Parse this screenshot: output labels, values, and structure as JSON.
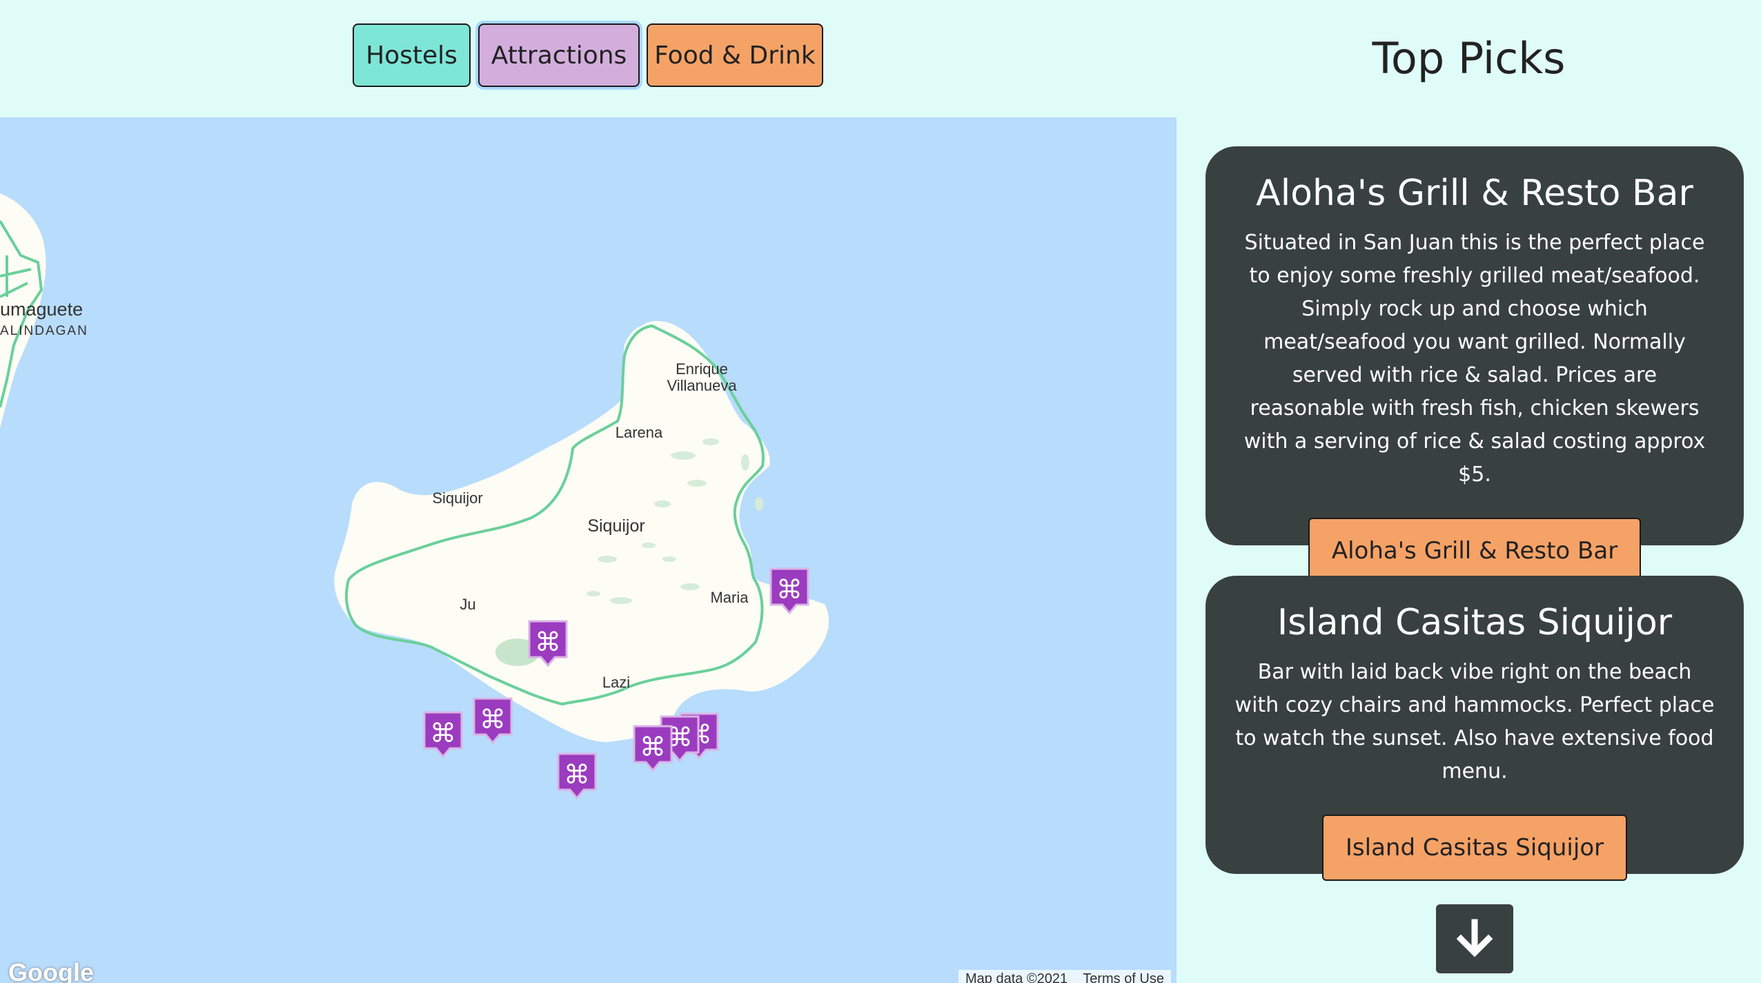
{
  "categories": {
    "hostels": "Hostels",
    "attractions": "Attractions",
    "food_drink": "Food & Drink"
  },
  "map": {
    "labels": {
      "dumaguete": "umaguete",
      "calindagan": "ALINDAGAN",
      "enrique_line1": "Enrique",
      "enrique_line2": "Villanueva",
      "larena": "Larena",
      "siquijor_town": "Siquijor",
      "siquijor_island": "Siquijor",
      "maria": "Maria",
      "san_juan_partial": "Ju",
      "lazi": "Lazi"
    },
    "marker_icon": "command-symbol-pin-icon",
    "marker_glyph": "⌘",
    "marker_color": "#9b3bbf",
    "water_color": "#b8dcfc",
    "land_color": "#fdfdf5",
    "road_color": "#6bcf9c",
    "google_logo": "Google",
    "attribution": "Map data ©2021",
    "terms": "Terms of Use"
  },
  "sidebar": {
    "title": "Top Picks",
    "cards": [
      {
        "name": "Aloha's Grill & Resto Bar",
        "description": "Situated in San Juan this is the perfect place to enjoy some freshly grilled meat/seafood. Simply rock up and choose which meat/seafood you want grilled. Normally served with rice & salad. Prices are reasonable with fresh fish, chicken skewers with a serving of rice & salad costing approx $5.",
        "button": "Aloha's Grill & Resto Bar"
      },
      {
        "name": "Island Casitas Siquijor",
        "description": "Bar with laid back vibe right on the beach with cozy chairs and hammocks. Perfect place to watch the sunset. Also have extensive food menu.",
        "button": "Island Casitas Siquijor"
      }
    ],
    "scroll_icon": "arrow-down-icon"
  }
}
